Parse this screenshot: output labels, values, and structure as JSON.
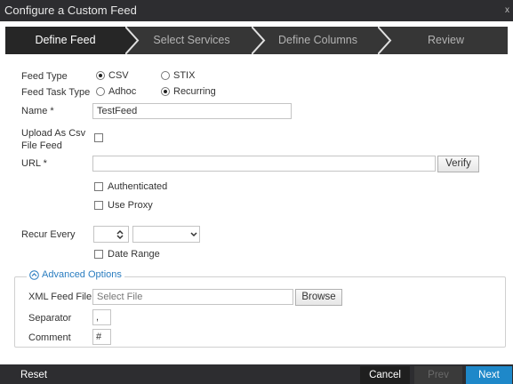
{
  "dialog": {
    "title": "Configure a Custom Feed",
    "close_glyph": "x"
  },
  "wizard": {
    "steps": [
      {
        "label": "Define Feed",
        "active": true
      },
      {
        "label": "Select Services",
        "active": false
      },
      {
        "label": "Define Columns",
        "active": false
      },
      {
        "label": "Review",
        "active": false
      }
    ]
  },
  "form": {
    "feed_type": {
      "label": "Feed Type",
      "options": [
        "CSV",
        "STIX"
      ],
      "selected": "CSV"
    },
    "feed_task_type": {
      "label": "Feed Task Type",
      "options": [
        "Adhoc",
        "Recurring"
      ],
      "selected": "Recurring"
    },
    "name": {
      "label": "Name *",
      "value": "TestFeed"
    },
    "upload_csv": {
      "label_line1": "Upload As Csv",
      "label_line2": "File Feed",
      "checked": false
    },
    "url": {
      "label": "URL *",
      "value": "",
      "verify_label": "Verify"
    },
    "authenticated": {
      "label": "Authenticated",
      "checked": false
    },
    "use_proxy": {
      "label": "Use Proxy",
      "checked": false
    },
    "recur_every": {
      "label": "Recur Every",
      "value": "",
      "unit": ""
    },
    "date_range": {
      "label": "Date Range",
      "checked": false
    }
  },
  "advanced": {
    "legend": "Advanced Options",
    "xml_feed_file": {
      "label": "XML Feed File",
      "placeholder": "Select File",
      "browse_label": "Browse"
    },
    "separator": {
      "label": "Separator",
      "value": ","
    },
    "comment": {
      "label": "Comment",
      "value": "#"
    }
  },
  "footer": {
    "reset": "Reset",
    "cancel": "Cancel",
    "prev": "Prev",
    "next": "Next"
  },
  "colors": {
    "accent": "#2a7dc0",
    "next_button": "#1e88c9",
    "dark_bar": "#2d2d30",
    "wizard_active": "#2a2a2a"
  }
}
